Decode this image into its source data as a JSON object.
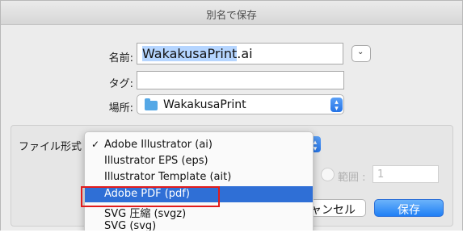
{
  "dialog": {
    "title": "別名で保存"
  },
  "form": {
    "name_label": "名前:",
    "name_selected": "WakakusaPrint",
    "name_ext": ".ai",
    "tags_label": "タグ:",
    "tags_value": "",
    "location_label": "場所:",
    "location_value": "WakakusaPrint"
  },
  "format": {
    "label": "ファイル形式",
    "options": [
      {
        "label": "Adobe Illustrator (ai)",
        "checked": true
      },
      {
        "label": "Illustrator EPS (eps)",
        "checked": false
      },
      {
        "label": "Illustrator Template (ait)",
        "checked": false
      },
      {
        "label": "Adobe PDF (pdf)",
        "checked": false,
        "highlighted": true
      },
      {
        "label": "SVG 圧縮 (svgz)",
        "checked": false
      },
      {
        "label": "SVG (svg)",
        "checked": false
      }
    ],
    "check_mark": "✓"
  },
  "range": {
    "label": "範囲 :",
    "value": "1"
  },
  "buttons": {
    "cancel": "ャンセル",
    "save": "保存"
  },
  "icons": {
    "expand": "chevron-down-icon",
    "stepper": "up-down-arrows-icon",
    "folder": "folder-icon"
  },
  "colors": {
    "accent": "#2f6fd6",
    "highlight_outline": "#e21b1b",
    "folder": "#55a8e6"
  }
}
